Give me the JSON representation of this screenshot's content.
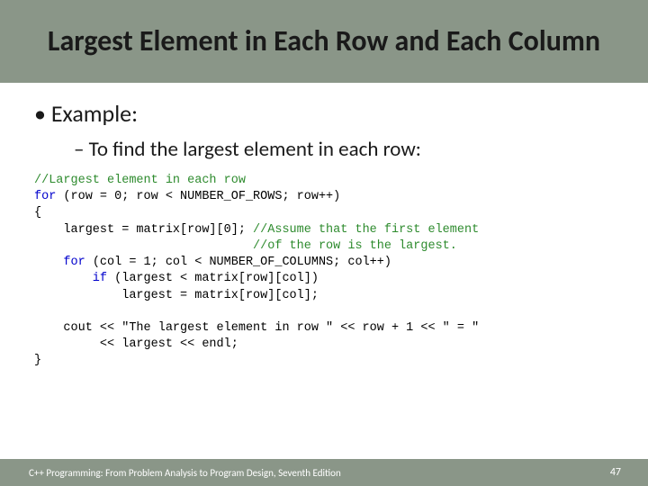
{
  "title": "Largest Element in Each Row and Each Column",
  "bullets": {
    "example": "Example:",
    "sub": "To find the largest element in each row:"
  },
  "code": {
    "c1": "//Largest element in each row",
    "l2a": "for",
    "l2b": " (row = 0; row < NUMBER_OF_ROWS; row++)",
    "l3": "{",
    "l4a": "    largest = matrix[row][0]; ",
    "l4b": "//Assume that the first element",
    "l5": "                              //of the row is the largest.",
    "l6a": "    for",
    "l6b": " (col = 1; col < NUMBER_OF_COLUMNS; col++)",
    "l7a": "        if",
    "l7b": " (largest < matrix[row][col])",
    "l8": "            largest = matrix[row][col];",
    "blank": "",
    "l9": "    cout << \"The largest element in row \" << row + 1 << \" = \"",
    "l10": "         << largest << endl;",
    "l11": "}"
  },
  "footer": {
    "text": "C++ Programming: From Problem Analysis to Program Design, Seventh Edition",
    "page": "47"
  }
}
